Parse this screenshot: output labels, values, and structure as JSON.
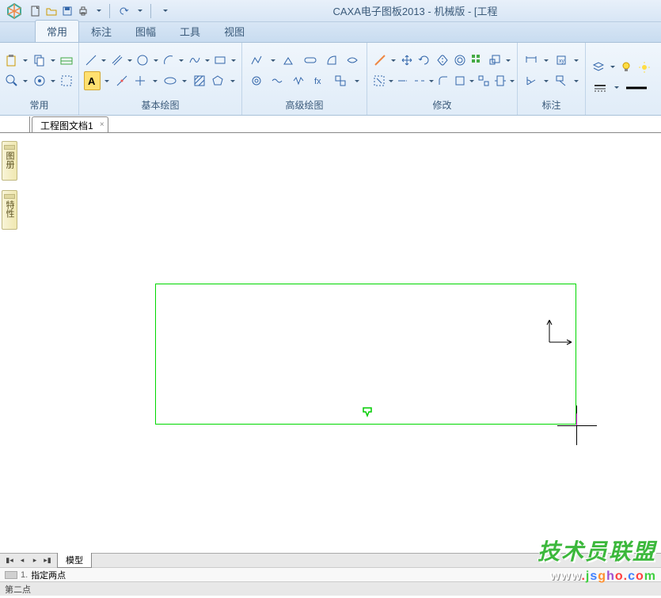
{
  "app": {
    "title": "CAXA电子图板2013 - 机械版 - [工程"
  },
  "tabs": {
    "items": [
      "常用",
      "标注",
      "图幅",
      "工具",
      "视图"
    ],
    "active": 0
  },
  "ribbon": {
    "groups": [
      {
        "label": "常用"
      },
      {
        "label": "基本绘图"
      },
      {
        "label": "高级绘图"
      },
      {
        "label": "修改"
      },
      {
        "label": "标注"
      },
      {
        "label": ""
      }
    ]
  },
  "document": {
    "tab_name": "工程图文档1"
  },
  "side_panels": {
    "panel1": "图册",
    "panel2": "特性"
  },
  "bottom": {
    "sheet_tab": "模型"
  },
  "command": {
    "num": "1.",
    "text": "指定两点"
  },
  "status": {
    "text": "第二点"
  },
  "watermark": {
    "line1": "技术员联盟",
    "line2_parts": [
      "www",
      ".",
      "j",
      "s",
      "g",
      "h",
      "o",
      ".",
      "c",
      "o",
      "m"
    ]
  }
}
